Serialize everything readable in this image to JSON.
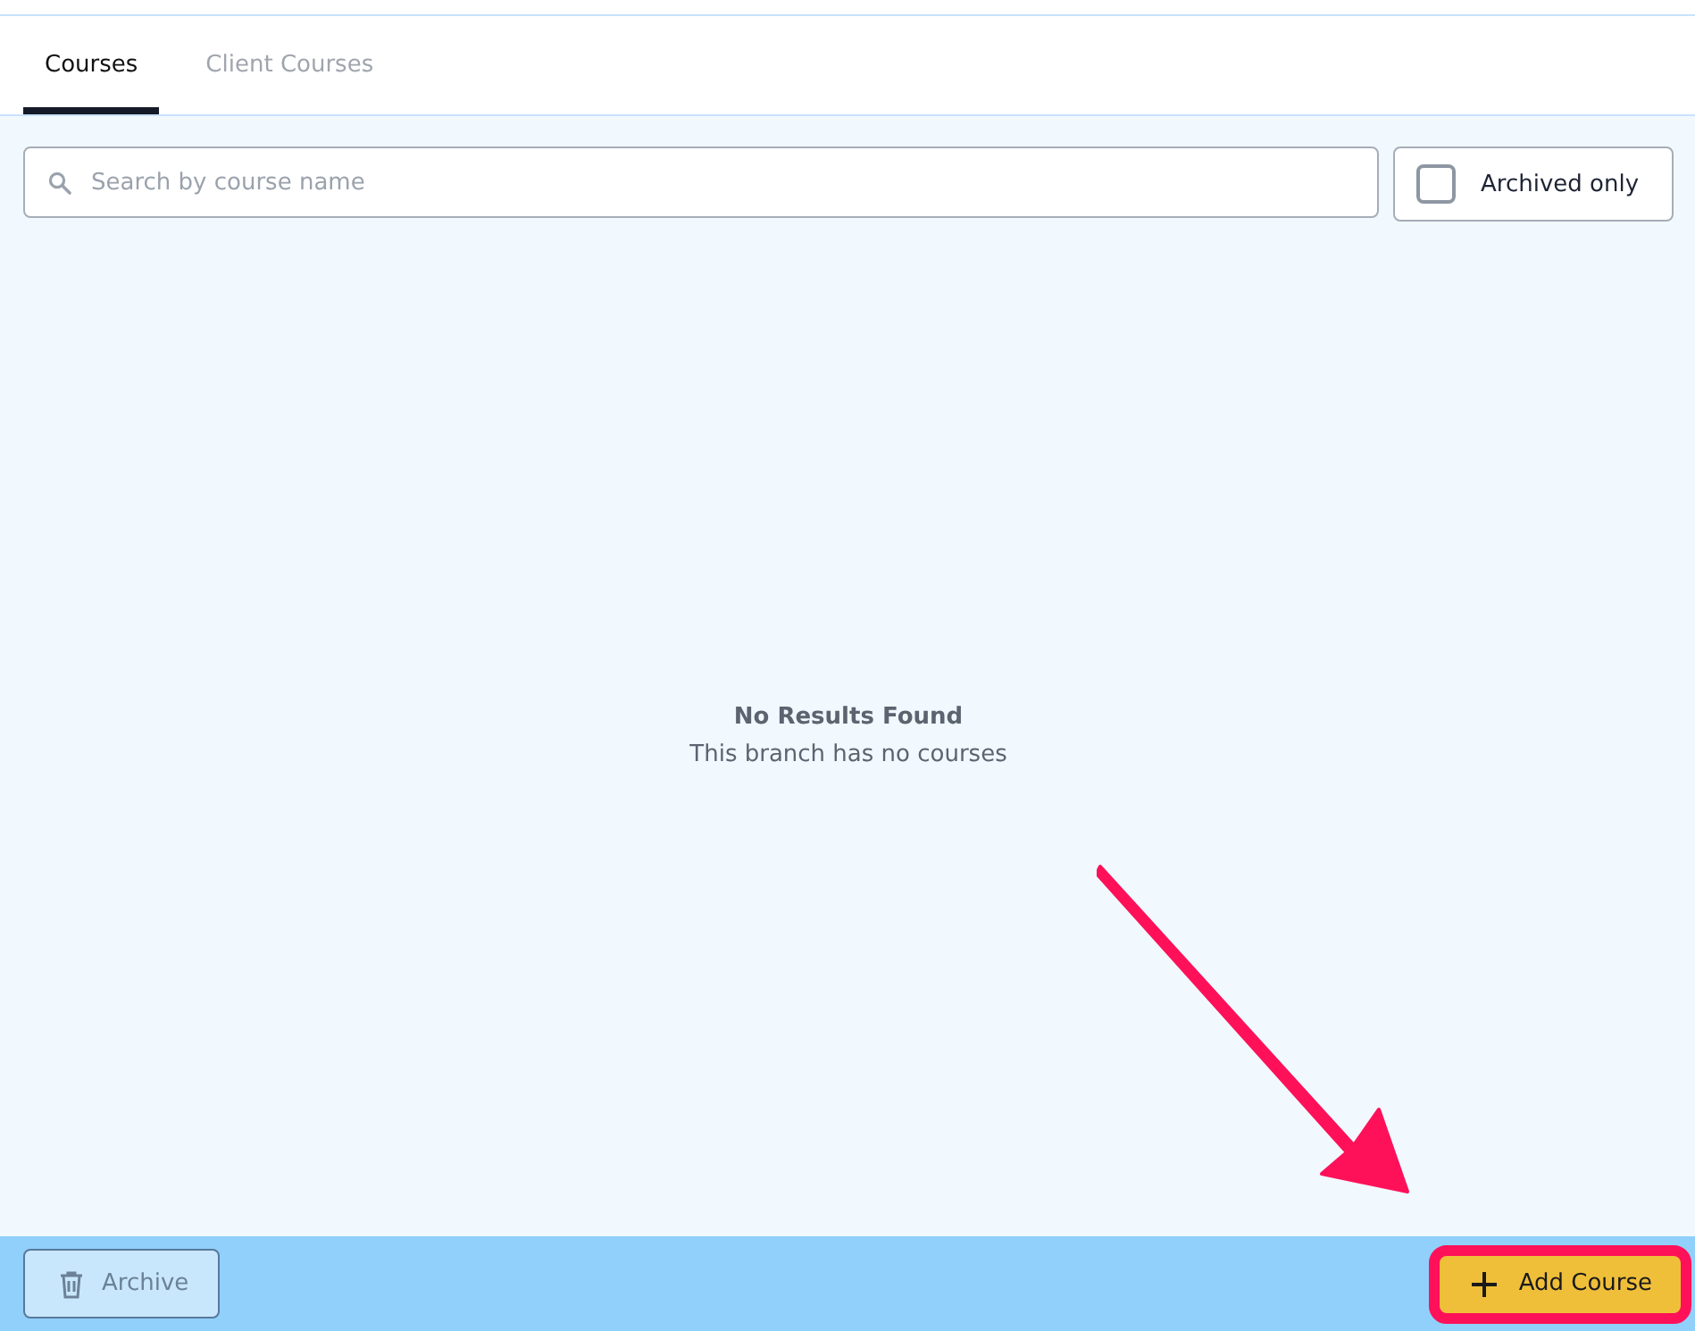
{
  "tabs": [
    {
      "label": "Courses",
      "selected": true
    },
    {
      "label": "Client Courses",
      "selected": false
    }
  ],
  "search": {
    "placeholder": "Search by course name"
  },
  "archived_filter": {
    "label": "Archived only",
    "checked": false
  },
  "empty_state": {
    "title": "No Results Found",
    "message": "This branch has no courses"
  },
  "footer": {
    "archive_button": {
      "label": "Archive",
      "disabled": true
    },
    "add_button": {
      "label": "Add Course",
      "highlighted": true
    }
  }
}
